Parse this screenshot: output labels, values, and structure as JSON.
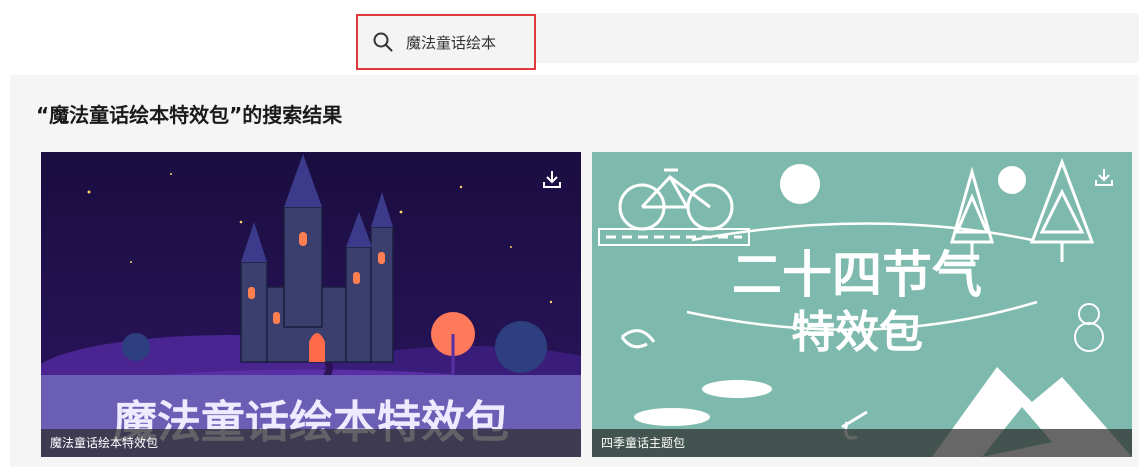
{
  "search": {
    "query": "魔法童话绘本",
    "icon": "search-icon"
  },
  "results": {
    "title": "“魔法童话绘本特效包”的搜索结果"
  },
  "cards": [
    {
      "art_text": "魔法童话绘本特效包",
      "caption": "魔法童话绘本特效包",
      "download_icon": "download-icon"
    },
    {
      "art_line1": "二十四节气",
      "art_line2": "特效包",
      "caption": "四季童话主题包",
      "download_icon": "download-icon"
    }
  ],
  "colors": {
    "highlight": "#e0393b",
    "card1_bg": "#1c0f44",
    "card2_bg": "#7db9ad"
  }
}
